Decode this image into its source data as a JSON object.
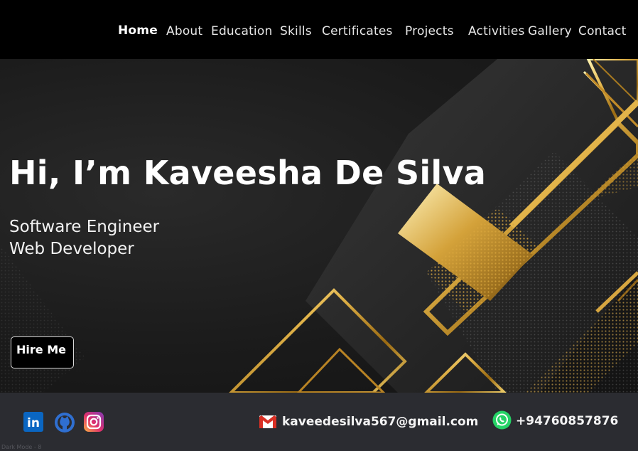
{
  "nav": {
    "items": [
      {
        "label": "Home"
      },
      {
        "label": "About"
      },
      {
        "label": "Education"
      },
      {
        "label": "Skills"
      },
      {
        "label": "Certificates"
      },
      {
        "label": "Projects"
      },
      {
        "label": "Activities"
      },
      {
        "label": "Gallery"
      },
      {
        "label": "Contact"
      }
    ],
    "active": "Home"
  },
  "hero": {
    "title": "Hi, I’m Kaveesha De Silva",
    "roles": [
      "Software Engineer",
      "Web Developer"
    ],
    "cta_label": "Hire Me"
  },
  "footer": {
    "social_icons": [
      "linkedin-icon",
      "github-icon",
      "instagram-icon"
    ],
    "linkedin_text": "in",
    "email": "kaveedesilva567@gmail.com",
    "phone": "+94760857876",
    "note": "Dark Mode - 8"
  },
  "colors": {
    "header_bg": "#000000",
    "footer_bg": "#2b2c31",
    "gold": "#c8962a",
    "linkedin": "#0a66c2",
    "github": "#2f6fd1",
    "whatsapp": "#25d366",
    "gmail_red": "#d93025"
  }
}
